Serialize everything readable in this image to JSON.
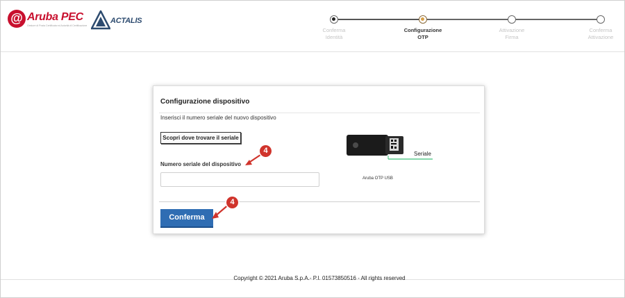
{
  "brand": {
    "aruba_mark": "@",
    "aruba_name": "Aruba PEC",
    "aruba_tagline": "Gestore di Posta Certificata ed Autorità di Certificazione",
    "actalis_name": "ACTALIS"
  },
  "stepper": {
    "steps": [
      {
        "line1": "Conferma",
        "line2": "Identità",
        "state": "done"
      },
      {
        "line1": "Configurazione",
        "line2": "OTP",
        "state": "current"
      },
      {
        "line1": "Attivazione",
        "line2": "Firma",
        "state": "todo"
      },
      {
        "line1": "Conferma",
        "line2": "Attivazione",
        "state": "todo"
      }
    ]
  },
  "card": {
    "title": "Configurazione dispositivo",
    "description": "Inserisci il numero seriale del nuovo dispositivo",
    "find_serial_button": "Scopri dove trovare il seriale",
    "serial_field_label": "Numero seriale del dispositivo",
    "serial_field_value": "",
    "serial_caption": "Seriale",
    "device_caption": "Aruba OTP USB",
    "confirm_button": "Conferma"
  },
  "annotations": [
    {
      "number": "4",
      "color": "#d0342c"
    },
    {
      "number": "4",
      "color": "#d0342c"
    }
  ],
  "footer": {
    "copyright": "Copyright © 2021 Aruba S.p.A.- P.I. 01573850516 - All rights reserved"
  },
  "colors": {
    "brand_red": "#c8102e",
    "primary_button": "#2f6db3",
    "annotation_red": "#d0342c",
    "serial_marker_green": "#3fc07a"
  }
}
